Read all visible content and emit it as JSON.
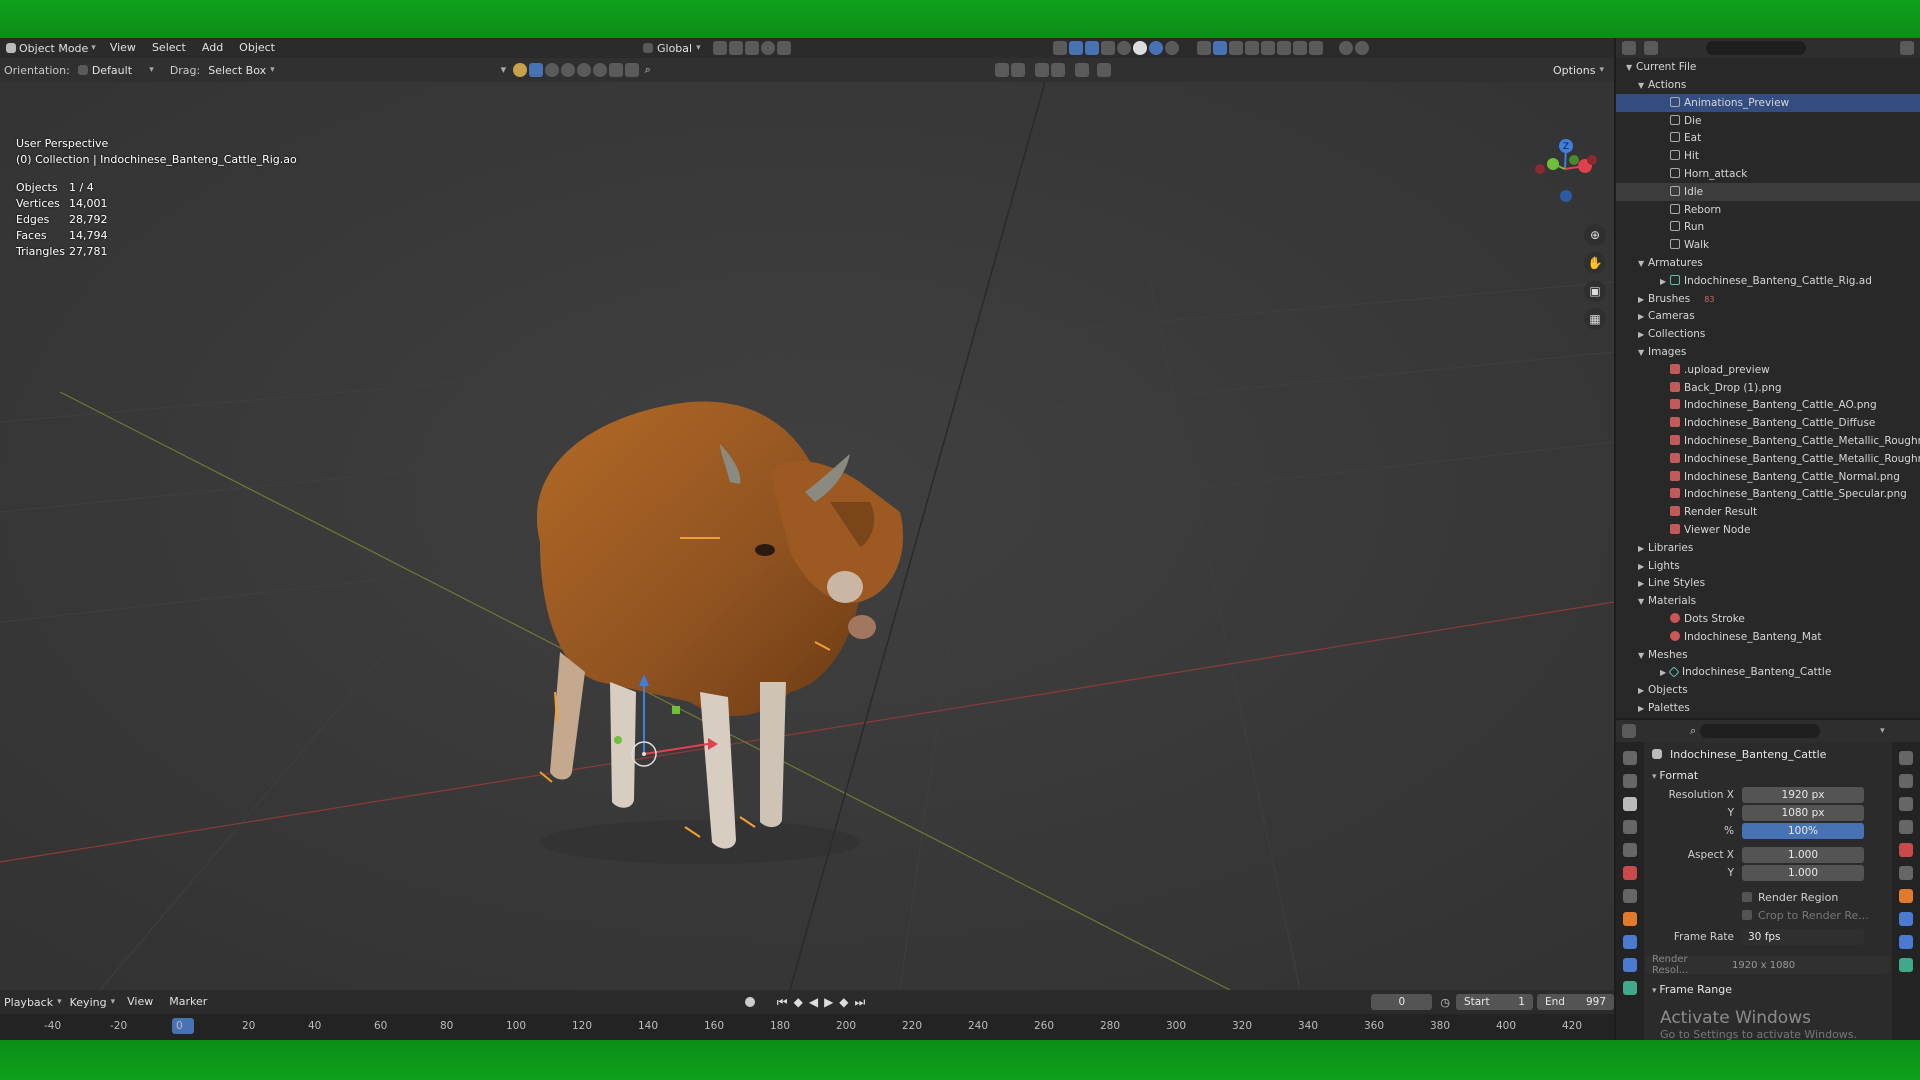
{
  "header": {
    "mode": "Object Mode",
    "menus": [
      "View",
      "Select",
      "Add",
      "Object"
    ],
    "orientation_label": "Global",
    "options_label": "Options"
  },
  "subbar": {
    "orientation_prefix": "Orientation:",
    "orientation_value": "Default",
    "drag_label": "Drag:",
    "drag_value": "Select Box"
  },
  "viewport": {
    "view_name": "User Perspective",
    "collection_line": "(0) Collection | Indochinese_Banteng_Cattle_Rig.ao",
    "stats": [
      {
        "label": "Objects",
        "value": "1 / 4"
      },
      {
        "label": "Vertices",
        "value": "14,001"
      },
      {
        "label": "Edges",
        "value": "28,792"
      },
      {
        "label": "Faces",
        "value": "14,794"
      },
      {
        "label": "Triangles",
        "value": "27,781"
      }
    ],
    "gizmo_z": "Z"
  },
  "outliner": {
    "root": "Current File",
    "rows": [
      {
        "label": "Actions",
        "level": 1,
        "kind": "folder",
        "open": true
      },
      {
        "label": "Animations_Preview",
        "level": 2,
        "kind": "action",
        "state": "active"
      },
      {
        "label": "Die",
        "level": 2,
        "kind": "action"
      },
      {
        "label": "Eat",
        "level": 2,
        "kind": "action"
      },
      {
        "label": "Hit",
        "level": 2,
        "kind": "action"
      },
      {
        "label": "Horn_attack",
        "level": 2,
        "kind": "action"
      },
      {
        "label": "Idle",
        "level": 2,
        "kind": "action",
        "state": "hl"
      },
      {
        "label": "Reborn",
        "level": 2,
        "kind": "action"
      },
      {
        "label": "Run",
        "level": 2,
        "kind": "action"
      },
      {
        "label": "Walk",
        "level": 2,
        "kind": "action"
      },
      {
        "label": "Armatures",
        "level": 1,
        "kind": "folder",
        "open": true
      },
      {
        "label": "Indochinese_Banteng_Cattle_Rig.ad",
        "level": 2,
        "kind": "armature",
        "collapsed": true
      },
      {
        "label": "Brushes",
        "level": 1,
        "kind": "folder",
        "badge": "83"
      },
      {
        "label": "Cameras",
        "level": 1,
        "kind": "folder"
      },
      {
        "label": "Collections",
        "level": 1,
        "kind": "folder"
      },
      {
        "label": "Images",
        "level": 1,
        "kind": "folder",
        "open": true
      },
      {
        "label": ".upload_preview",
        "level": 2,
        "kind": "image"
      },
      {
        "label": "Back_Drop (1).png",
        "level": 2,
        "kind": "image"
      },
      {
        "label": "Indochinese_Banteng_Cattle_AO.png",
        "level": 2,
        "kind": "image"
      },
      {
        "label": "Indochinese_Banteng_Cattle_Diffuse",
        "level": 2,
        "kind": "image"
      },
      {
        "label": "Indochinese_Banteng_Cattle_Metallic_Roughness",
        "level": 2,
        "kind": "image"
      },
      {
        "label": "Indochinese_Banteng_Cattle_Metallic_Roughness",
        "level": 2,
        "kind": "image"
      },
      {
        "label": "Indochinese_Banteng_Cattle_Normal.png",
        "level": 2,
        "kind": "image"
      },
      {
        "label": "Indochinese_Banteng_Cattle_Specular.png",
        "level": 2,
        "kind": "image"
      },
      {
        "label": "Render Result",
        "level": 2,
        "kind": "image"
      },
      {
        "label": "Viewer Node",
        "level": 2,
        "kind": "image"
      },
      {
        "label": "Libraries",
        "level": 1,
        "kind": "folder"
      },
      {
        "label": "Lights",
        "level": 1,
        "kind": "folder"
      },
      {
        "label": "Line Styles",
        "level": 1,
        "kind": "folder"
      },
      {
        "label": "Materials",
        "level": 1,
        "kind": "folder",
        "open": true
      },
      {
        "label": "Dots Stroke",
        "level": 2,
        "kind": "material"
      },
      {
        "label": "Indochinese_Banteng_Mat",
        "level": 2,
        "kind": "material"
      },
      {
        "label": "Meshes",
        "level": 1,
        "kind": "folder",
        "open": true
      },
      {
        "label": "Indochinese_Banteng_Cattle",
        "level": 2,
        "kind": "mesh",
        "collapsed": true
      },
      {
        "label": "Objects",
        "level": 1,
        "kind": "folder"
      },
      {
        "label": "Palettes",
        "level": 1,
        "kind": "folder"
      }
    ]
  },
  "properties": {
    "object_name": "Indochinese_Banteng_Cattle",
    "panel_title": "Format",
    "fields": [
      {
        "label": "Resolution X",
        "value": "1920 px"
      },
      {
        "label": "Y",
        "value": "1080 px"
      },
      {
        "label": "%",
        "value": "100%",
        "accent": true
      },
      {
        "label": "Aspect X",
        "value": "1.000",
        "gap": true
      },
      {
        "label": "Y",
        "value": "1.000"
      }
    ],
    "render_region": "Render Region",
    "crop_label": "Crop to Render Re...",
    "frame_rate_label": "Frame Rate",
    "frame_rate_value": "30 fps",
    "render_resol_label": "Render Resol...",
    "render_resol_value": "1920 x 1080",
    "frame_range": "Frame Range"
  },
  "timeline": {
    "menus": [
      "Playback",
      "Keying",
      "View",
      "Marker"
    ],
    "current_frame": "0",
    "start_label": "Start",
    "start_value": "1",
    "end_label": "End",
    "end_value": "997",
    "ticks": [
      "-40",
      "-20",
      "0",
      "20",
      "40",
      "60",
      "80",
      "100",
      "120",
      "140",
      "160",
      "180",
      "200",
      "220",
      "240",
      "260",
      "280",
      "300",
      "320",
      "340",
      "360",
      "380",
      "400",
      "420"
    ]
  },
  "watermark": {
    "line1": "Activate Windows",
    "line2": "Go to Settings to activate Windows."
  },
  "colors": {
    "accent": "#4772b3",
    "greenscreen": "#0f9e1a",
    "viewport_bg": "#3a3a3a"
  }
}
